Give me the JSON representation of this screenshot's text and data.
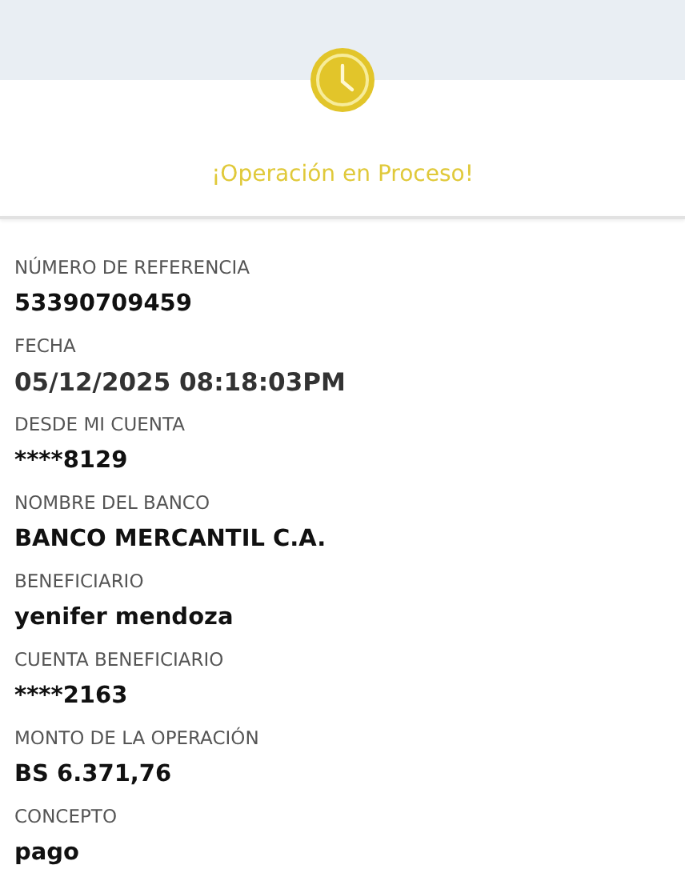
{
  "status": {
    "title": "¡Operación en Proceso!"
  },
  "fields": [
    {
      "label": "NÚMERO DE REFERENCIA",
      "value": "53390709459"
    },
    {
      "label": "FECHA",
      "value": "05/12/2025 08:18:03PM"
    },
    {
      "label": "DESDE MI CUENTA",
      "value": "****8129"
    },
    {
      "label": "NOMBRE DEL BANCO",
      "value": "BANCO MERCANTIL C.A."
    },
    {
      "label": "BENEFICIARIO",
      "value": "yenifer mendoza"
    },
    {
      "label": "CUENTA BENEFICIARIO",
      "value": "****2163"
    },
    {
      "label": "MONTO DE LA OPERACIÓN",
      "value": "BS 6.371,76"
    },
    {
      "label": "CONCEPTO",
      "value": "pago"
    }
  ]
}
